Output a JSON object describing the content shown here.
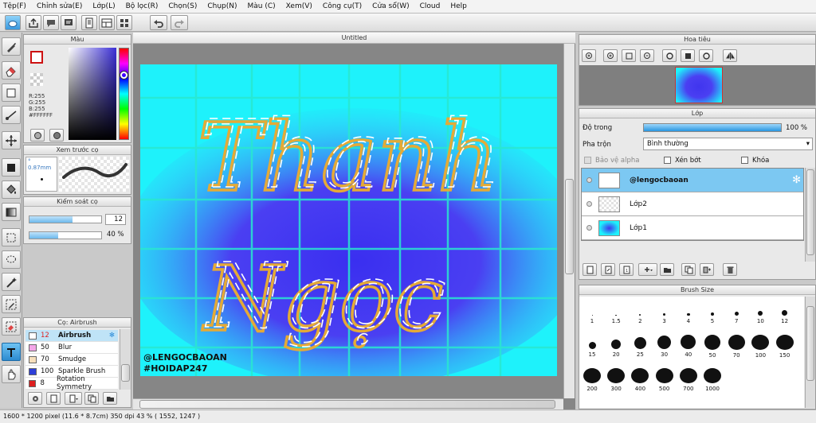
{
  "menu": [
    "Tệp(F)",
    "Chỉnh sửa(E)",
    "Lớp(L)",
    "Bộ lọc(R)",
    "Chọn(S)",
    "Chụp(N)",
    "Màu (C)",
    "Xem(V)",
    "Công cụ(T)",
    "Cửa sổ(W)",
    "Cloud",
    "Help"
  ],
  "panels": {
    "color": "Màu",
    "brush_preview": "Xem trước cọ",
    "brush_control": "Kiểm soát cọ",
    "brush_list": "Cọ: Airbrush",
    "canvas": "Untitled",
    "navigator": "Hoa tiêu",
    "layers": "Lớp",
    "brush_size": "Brush Size"
  },
  "color": {
    "r": "R:255",
    "g": "G:255",
    "b": "B:255",
    "hex": "#FFFFFF",
    "primary": "#cc1111",
    "secondary": "#ffffff"
  },
  "brush_preview": {
    "size": "° 0.87mm"
  },
  "brush_control": {
    "size_value": "12",
    "opacity_value": "40 %",
    "size_fill": 0.6,
    "opacity_fill": 0.4
  },
  "brushes": [
    {
      "size": "12",
      "name": "Airbrush",
      "color": "#ffffff",
      "selected": true
    },
    {
      "size": "50",
      "name": "Blur",
      "color": "#f4a6e8",
      "selected": false
    },
    {
      "size": "70",
      "name": "Smudge",
      "color": "#f7e0bc",
      "selected": false
    },
    {
      "size": "100",
      "name": "Sparkle Brush",
      "color": "#2d3fd8",
      "selected": false
    },
    {
      "size": "8",
      "name": "Rotation Symmetry",
      "color": "#dd1f1f",
      "selected": false
    }
  ],
  "canvas_text": {
    "line1": "Thanh",
    "line2": "Ngọc",
    "watermark1": "@LENGOCBAOAN",
    "watermark2": "#HOIDAP247"
  },
  "layers": {
    "opacity_label": "Độ trong",
    "opacity_value": "100 %",
    "opacity_fill": 1.0,
    "blend_label": "Pha trộn",
    "blend_value": "Bình thường",
    "protect_alpha": "Bảo vệ alpha",
    "clipping": "Xén bớt",
    "lock": "Khóa",
    "items": [
      {
        "name": "@lengocbaoan",
        "selected": true
      },
      {
        "name": "Lớp2",
        "selected": false
      },
      {
        "name": "Lớp1",
        "selected": false
      }
    ]
  },
  "brush_sizes": [
    {
      "label": "1",
      "d": 1
    },
    {
      "label": "1.5",
      "d": 1.5
    },
    {
      "label": "2",
      "d": 2
    },
    {
      "label": "3",
      "d": 3
    },
    {
      "label": "4",
      "d": 3.5
    },
    {
      "label": "5",
      "d": 4
    },
    {
      "label": "7",
      "d": 5
    },
    {
      "label": "10",
      "d": 6
    },
    {
      "label": "12",
      "d": 7
    },
    {
      "label": "15",
      "d": 9
    },
    {
      "label": "20",
      "d": 12
    },
    {
      "label": "25",
      "d": 15
    },
    {
      "label": "30",
      "d": 17
    },
    {
      "label": "40",
      "d": 19
    },
    {
      "label": "50",
      "d": 20
    },
    {
      "label": "70",
      "d": 21
    },
    {
      "label": "100",
      "d": 22
    },
    {
      "label": "150",
      "d": 22
    },
    {
      "label": "200",
      "d": 22
    },
    {
      "label": "300",
      "d": 22
    },
    {
      "label": "400",
      "d": 22
    },
    {
      "label": "500",
      "d": 22
    },
    {
      "label": "700",
      "d": 22
    },
    {
      "label": "1000",
      "d": 22
    }
  ],
  "status": "1600 * 1200 pixel   (11.6 * 8.7cm)   350 dpi   43 %   ( 1552, 1247 )"
}
